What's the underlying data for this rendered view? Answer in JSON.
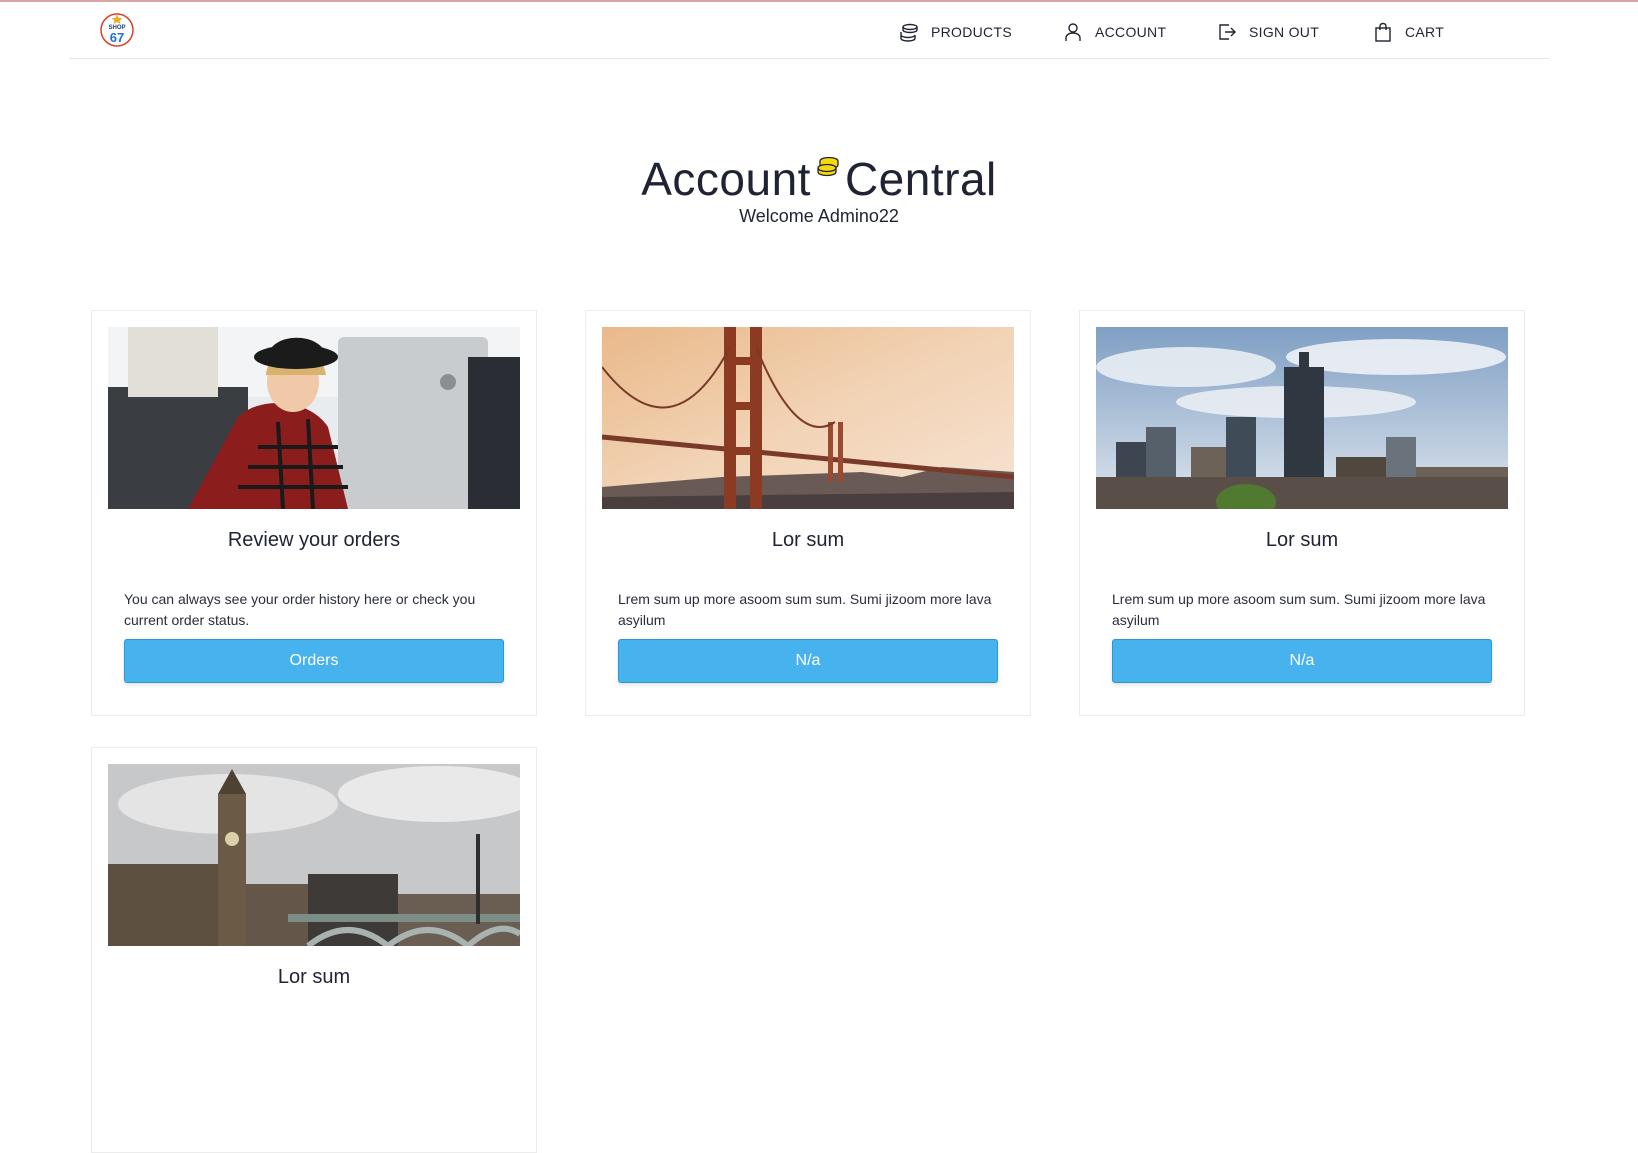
{
  "nav": {
    "logo_text_top": "SHOP",
    "logo_text_num": "67",
    "items": [
      {
        "label": "PRODUCTS",
        "icon": "coins-icon"
      },
      {
        "label": "ACCOUNT",
        "icon": "user-icon"
      },
      {
        "label": "SIGN OUT",
        "icon": "sign-out-icon"
      },
      {
        "label": "CART",
        "icon": "shopping-bag-icon"
      }
    ]
  },
  "hero": {
    "title_left": "Account",
    "title_right": "Central",
    "welcome": "Welcome Admino22"
  },
  "cards": [
    {
      "image": "office-woman-photo",
      "title": "Review your orders",
      "text": "You can always see your order history here or check you current order status.",
      "button": "Orders"
    },
    {
      "image": "golden-gate-bridge-photo",
      "title": "Lor sum",
      "text": "Lrem sum up more asoom sum sum. Sumi jizoom more lava asyilum",
      "button": "N/a"
    },
    {
      "image": "city-skyline-photo",
      "title": "Lor sum",
      "text": "Lrem sum up more asoom sum sum. Sumi jizoom more lava asyilum",
      "button": "N/a"
    },
    {
      "image": "big-ben-london-photo",
      "title": "Lor sum"
    }
  ],
  "colors": {
    "button": "#46b2ee",
    "text": "#1f2333",
    "coin_accent": "#f5d90a"
  }
}
